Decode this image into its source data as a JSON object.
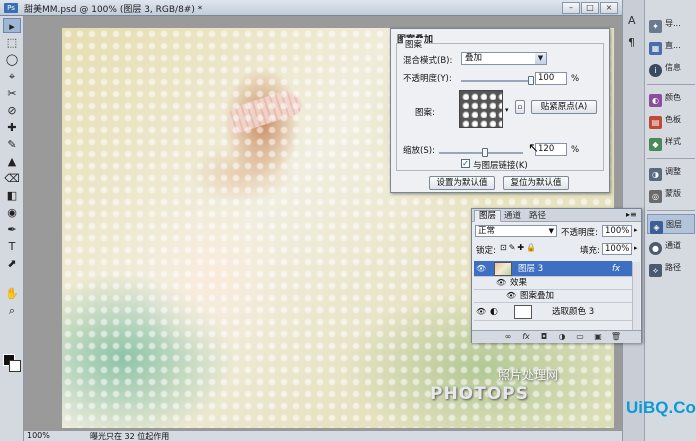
{
  "document": {
    "title": "甜美MM.psd @ 100% (图层 3, RGB/8#) *",
    "title_icon": "Ps",
    "minimize": "–",
    "maximize": "□",
    "close": "×"
  },
  "status_bar": {
    "zoom": "100%",
    "message": "曝光只在 32 位起作用"
  },
  "watermark": {
    "text": "PHOTOPS",
    "chinese": "照片处理网"
  },
  "logo": {
    "text": "UiBQ.CoM"
  },
  "pattern_dialog": {
    "title": "图案叠加",
    "group_label": "图案",
    "blend_mode_label": "混合模式(B):",
    "blend_mode_value": "叠加",
    "opacity_label": "不透明度(Y):",
    "opacity_value": "100",
    "opacity_unit": "%",
    "pattern_label": "图案:",
    "snap_button": "贴紧原点(A)",
    "scale_label": "缩放(S):",
    "scale_value": "120",
    "scale_unit": "%",
    "link_checkbox_label": "与图层链接(K)",
    "link_checked": true,
    "default_button": "设置为默认值",
    "reset_button": "复位为默认值",
    "opacity_fraction": 1.0,
    "scale_fraction": 0.55
  },
  "layers_panel": {
    "tabs": [
      "图层",
      "通道",
      "路径"
    ],
    "blend_mode": "正常",
    "opacity_label": "不透明度:",
    "opacity_value": "100%",
    "lock_label": "锁定:",
    "fill_label": "填充:",
    "fill_value": "100%",
    "layers": [
      {
        "name": "图层 3",
        "selected": true,
        "fx": "fx"
      },
      {
        "name": "效果",
        "selected": false
      },
      {
        "name": "图案叠加",
        "selected": false
      },
      {
        "name": "选取颜色 3",
        "selected": false
      }
    ]
  },
  "dock": {
    "items": [
      {
        "label": "导...",
        "color": "#6b7a8f"
      },
      {
        "label": "直...",
        "color": "#4a6da8"
      },
      {
        "label": "信息",
        "color": "#3a4a60"
      },
      {
        "label": "颜色",
        "color": "#8a4f9a"
      },
      {
        "label": "色板",
        "color": "#c04a3a"
      },
      {
        "label": "样式",
        "color": "#4a8a5a"
      },
      {
        "label": "调整",
        "color": "#5a6a80"
      },
      {
        "label": "蒙版",
        "color": "#6a6a6a"
      },
      {
        "label": "图层",
        "color": "#3c5f95"
      },
      {
        "label": "通道",
        "color": "#4a5a70"
      },
      {
        "label": "路径",
        "color": "#4a5a70"
      }
    ]
  },
  "toolbar": {
    "tools": [
      "▸",
      "⬚",
      "◯",
      "⌖",
      "✂",
      "⊘",
      "✚",
      "✎",
      "▲",
      "⌫",
      "◧",
      "◉",
      "✒",
      "T",
      "⬈",
      "✋",
      "⌕"
    ]
  },
  "colors": {
    "accent": "#3d6fc3",
    "foreground": "#111111",
    "background": "#ffffff"
  }
}
